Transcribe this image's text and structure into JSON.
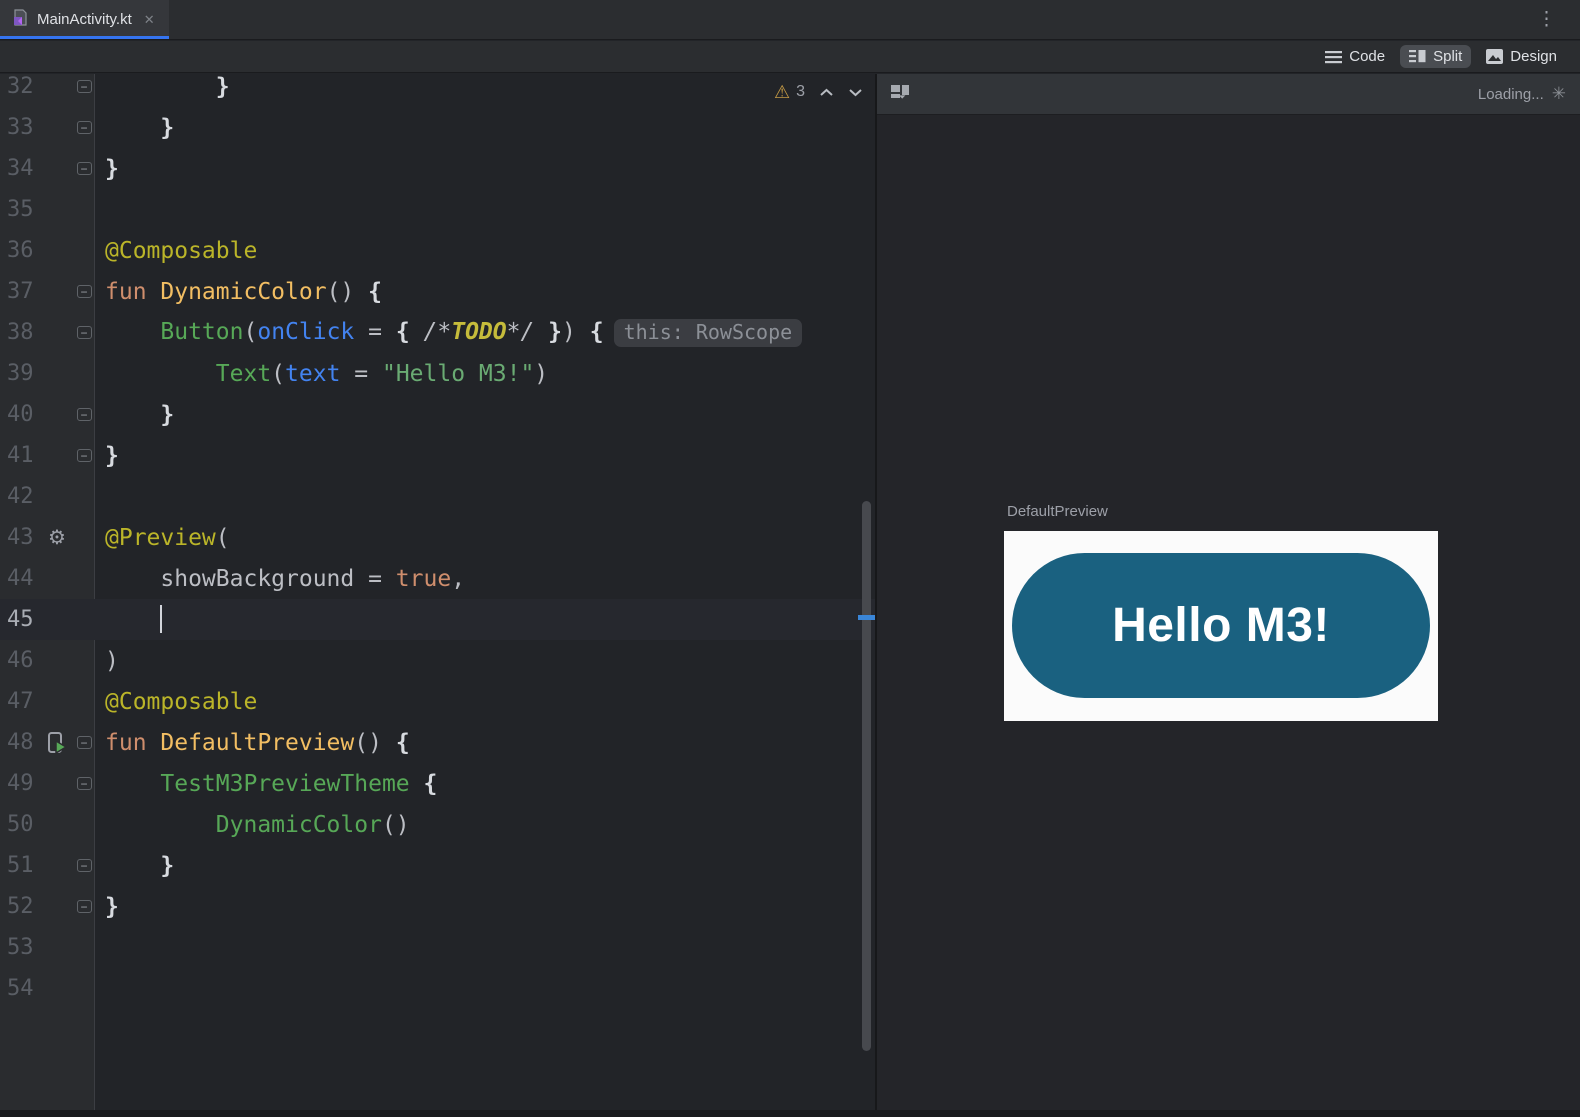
{
  "tab_bar": {
    "tabs": [
      {
        "label": "MainActivity.kt",
        "active": true,
        "icon": "kotlin-file-icon",
        "close_glyph": "✕"
      }
    ],
    "overflow_menu_glyph": "⋮"
  },
  "view_modes": {
    "items": [
      {
        "label": "Code",
        "icon": "code-view-icon",
        "selected": false
      },
      {
        "label": "Split",
        "icon": "split-view-icon",
        "selected": true
      },
      {
        "label": "Design",
        "icon": "design-view-icon",
        "selected": false
      }
    ]
  },
  "editor": {
    "warnings": {
      "count": "3"
    },
    "caret_line": 45,
    "lines": [
      {
        "n": 32,
        "fold": true,
        "segs": [
          {
            "t": "        ",
            "s": "p"
          },
          {
            "t": "}",
            "s": "br"
          }
        ]
      },
      {
        "n": 33,
        "fold": true,
        "segs": [
          {
            "t": "    ",
            "s": "p"
          },
          {
            "t": "}",
            "s": "br"
          }
        ]
      },
      {
        "n": 34,
        "fold": true,
        "segs": [
          {
            "t": "}",
            "s": "br"
          }
        ]
      },
      {
        "n": 35,
        "segs": []
      },
      {
        "n": 36,
        "segs": [
          {
            "t": "@Composable",
            "s": "ann"
          }
        ]
      },
      {
        "n": 37,
        "fold": true,
        "segs": [
          {
            "t": "fun ",
            "s": "kw"
          },
          {
            "t": "DynamicColor",
            "s": "fd"
          },
          {
            "t": "() ",
            "s": "p"
          },
          {
            "t": "{",
            "s": "br"
          }
        ]
      },
      {
        "n": 38,
        "fold": true,
        "segs": [
          {
            "t": "    ",
            "s": "p"
          },
          {
            "t": "Button",
            "s": "fc"
          },
          {
            "t": "(",
            "s": "p"
          },
          {
            "t": "onClick",
            "s": "prm"
          },
          {
            "t": " = ",
            "s": "p"
          },
          {
            "t": "{ ",
            "s": "br"
          },
          {
            "t": "/*",
            "s": "cmt"
          },
          {
            "t": "TODO",
            "s": "todo"
          },
          {
            "t": "*/",
            "s": "cmt"
          },
          {
            "t": " }",
            "s": "br"
          },
          {
            "t": ") ",
            "s": "p"
          },
          {
            "t": "{",
            "s": "br"
          },
          {
            "inlay": "this: RowScope"
          }
        ]
      },
      {
        "n": 39,
        "segs": [
          {
            "t": "        ",
            "s": "p"
          },
          {
            "t": "Text",
            "s": "fc"
          },
          {
            "t": "(",
            "s": "p"
          },
          {
            "t": "text",
            "s": "prm"
          },
          {
            "t": " = ",
            "s": "p"
          },
          {
            "t": "\"Hello M3!\"",
            "s": "str"
          },
          {
            "t": ")",
            "s": "p"
          }
        ]
      },
      {
        "n": 40,
        "fold": true,
        "segs": [
          {
            "t": "    ",
            "s": "p"
          },
          {
            "t": "}",
            "s": "br"
          }
        ]
      },
      {
        "n": 41,
        "fold": true,
        "segs": [
          {
            "t": "}",
            "s": "br"
          }
        ]
      },
      {
        "n": 42,
        "segs": []
      },
      {
        "n": 43,
        "icon": "gear",
        "segs": [
          {
            "t": "@Preview",
            "s": "ann"
          },
          {
            "t": "(",
            "s": "p"
          }
        ]
      },
      {
        "n": 44,
        "segs": [
          {
            "t": "    showBackground = ",
            "s": "p"
          },
          {
            "t": "true",
            "s": "kw"
          },
          {
            "t": ",",
            "s": "p"
          }
        ]
      },
      {
        "n": 45,
        "segs": [
          {
            "t": "    ",
            "s": "p"
          },
          {
            "caret": true
          }
        ]
      },
      {
        "n": 46,
        "segs": [
          {
            "t": ")",
            "s": "p"
          }
        ]
      },
      {
        "n": 47,
        "segs": [
          {
            "t": "@Composable",
            "s": "ann"
          }
        ]
      },
      {
        "n": 48,
        "fold": true,
        "icon": "run",
        "segs": [
          {
            "t": "fun ",
            "s": "kw"
          },
          {
            "t": "DefaultPreview",
            "s": "fd"
          },
          {
            "t": "() ",
            "s": "p"
          },
          {
            "t": "{",
            "s": "br"
          }
        ]
      },
      {
        "n": 49,
        "fold": true,
        "segs": [
          {
            "t": "    ",
            "s": "p"
          },
          {
            "t": "TestM3PreviewTheme ",
            "s": "fc"
          },
          {
            "t": "{",
            "s": "br"
          }
        ]
      },
      {
        "n": 50,
        "segs": [
          {
            "t": "        ",
            "s": "p"
          },
          {
            "t": "DynamicColor",
            "s": "fc"
          },
          {
            "t": "()",
            "s": "p"
          }
        ]
      },
      {
        "n": 51,
        "fold": true,
        "segs": [
          {
            "t": "    ",
            "s": "p"
          },
          {
            "t": "}",
            "s": "br"
          }
        ]
      },
      {
        "n": 52,
        "fold": true,
        "segs": [
          {
            "t": "}",
            "s": "br"
          }
        ]
      },
      {
        "n": 53,
        "segs": []
      },
      {
        "n": 54,
        "segs": []
      }
    ]
  },
  "preview": {
    "toolbar": {
      "status": "Loading...",
      "spinner_glyph": "✳"
    },
    "preview_label": "DefaultPreview",
    "button": {
      "text": "Hello M3!",
      "bg": "#1A6180",
      "fg": "#FFFFFF"
    }
  },
  "colors": {
    "accent_blue": "#3574F0",
    "annotation": "#BBB529",
    "keyword": "#CF8E6D",
    "function_decl": "#F2BE63",
    "function_call": "#57A857",
    "parameter": "#4383F0",
    "string": "#6AAB73",
    "plain": "#BCBEC4",
    "line_number": "#5A5E65",
    "preview_button_blue": "#1A6180"
  }
}
